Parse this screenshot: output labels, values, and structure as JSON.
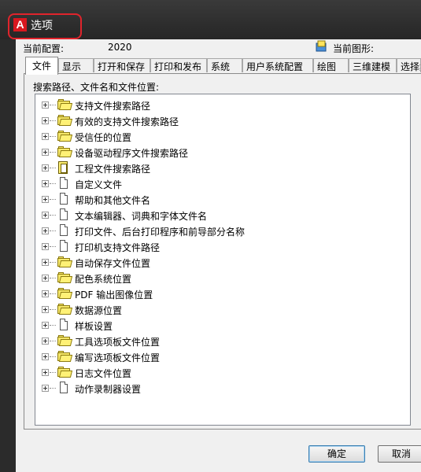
{
  "window": {
    "title": "选项"
  },
  "header": {
    "profile_label": "当前配置:",
    "profile_value": "2020",
    "drawing_label": "当前图形:"
  },
  "tabs": [
    {
      "label": "文件",
      "active": true
    },
    {
      "label": "显示"
    },
    {
      "label": "打开和保存"
    },
    {
      "label": "打印和发布"
    },
    {
      "label": "系统"
    },
    {
      "label": "用户系统配置"
    },
    {
      "label": "绘图"
    },
    {
      "label": "三维建模"
    },
    {
      "label": "选择集"
    }
  ],
  "files_tab": {
    "search_label": "搜索路径、文件名和文件位置:",
    "items": [
      {
        "label": "支持文件搜索路径",
        "icon": "folder-icon"
      },
      {
        "label": "有效的支持文件搜索路径",
        "icon": "folder-icon"
      },
      {
        "label": "受信任的位置",
        "icon": "folder-icon"
      },
      {
        "label": "设备驱动程序文件搜索路径",
        "icon": "folder-icon"
      },
      {
        "label": "工程文件搜索路径",
        "icon": "project-icon"
      },
      {
        "label": "自定义文件",
        "icon": "document-icon"
      },
      {
        "label": "帮助和其他文件名",
        "icon": "document-icon"
      },
      {
        "label": "文本编辑器、词典和字体文件名",
        "icon": "document-icon"
      },
      {
        "label": "打印文件、后台打印程序和前导部分名称",
        "icon": "document-icon"
      },
      {
        "label": "打印机支持文件路径",
        "icon": "document-icon"
      },
      {
        "label": "自动保存文件位置",
        "icon": "folder-icon"
      },
      {
        "label": "配色系统位置",
        "icon": "folder-icon"
      },
      {
        "label": "PDF 输出图像位置",
        "icon": "folder-icon"
      },
      {
        "label": "数据源位置",
        "icon": "folder-icon"
      },
      {
        "label": "样板设置",
        "icon": "document-icon"
      },
      {
        "label": "工具选项板文件位置",
        "icon": "folder-icon"
      },
      {
        "label": "编写选项板文件位置",
        "icon": "folder-icon"
      },
      {
        "label": "日志文件位置",
        "icon": "folder-icon"
      },
      {
        "label": "动作录制器设置",
        "icon": "document-icon"
      }
    ]
  },
  "buttons": {
    "ok": "确定",
    "cancel": "取消"
  }
}
